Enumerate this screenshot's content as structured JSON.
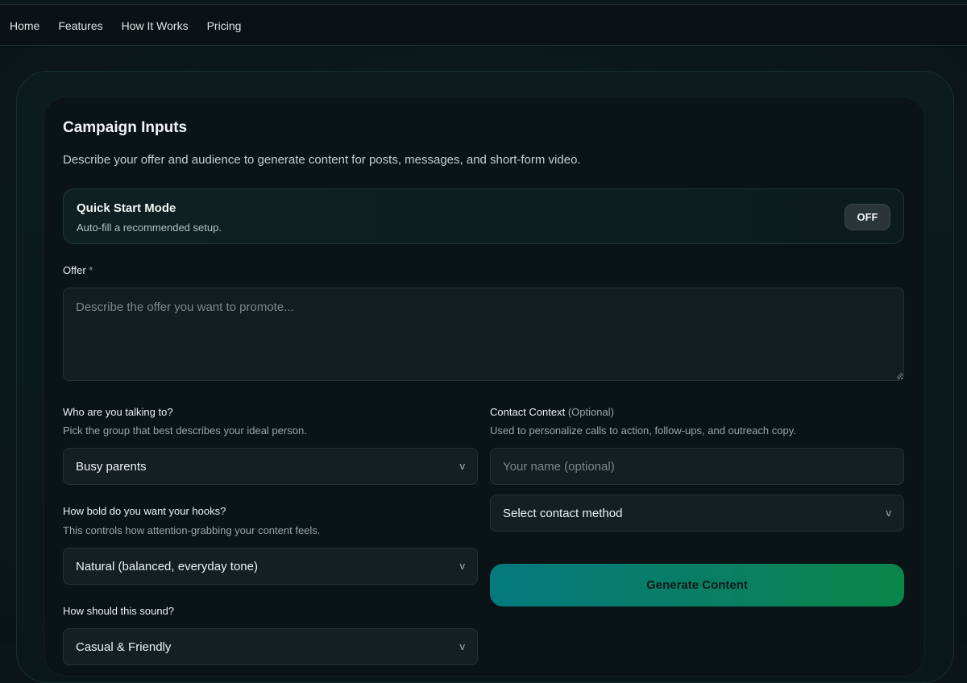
{
  "nav": {
    "items": [
      "Home",
      "Features",
      "How It Works",
      "Pricing"
    ]
  },
  "header": {
    "title": "Campaign Inputs",
    "subtitle": "Describe your offer and audience to generate content for posts, messages, and short-form video."
  },
  "quick_start": {
    "title": "Quick Start Mode",
    "description": "Auto-fill a recommended setup.",
    "toggle_label": "OFF"
  },
  "offer": {
    "label": "Offer",
    "required_mark": "*",
    "placeholder": "Describe the offer you want to promote...",
    "value": ""
  },
  "audience": {
    "label": "Who are you talking to?",
    "help": "Pick the group that best describes your ideal person.",
    "selected": "Busy parents"
  },
  "hooks": {
    "label": "How bold do you want your hooks?",
    "help": "This controls how attention-grabbing your content feels.",
    "selected": "Natural (balanced, everyday tone)"
  },
  "tone": {
    "label": "How should this sound?",
    "selected": "Casual & Friendly"
  },
  "contact": {
    "label": "Contact Context",
    "optional_mark": "(Optional)",
    "help": "Used to personalize calls to action, follow-ups, and outreach copy.",
    "name_placeholder": "Your name (optional)",
    "method_selected": "Select contact method"
  },
  "actions": {
    "generate_label": "Generate Content"
  },
  "icons": {
    "chevron": "chevron-down-icon",
    "chevron_glyph": "v"
  },
  "colors": {
    "accent_start": "#047a7e",
    "accent_end": "#0a8548",
    "background": "#0b1517"
  }
}
